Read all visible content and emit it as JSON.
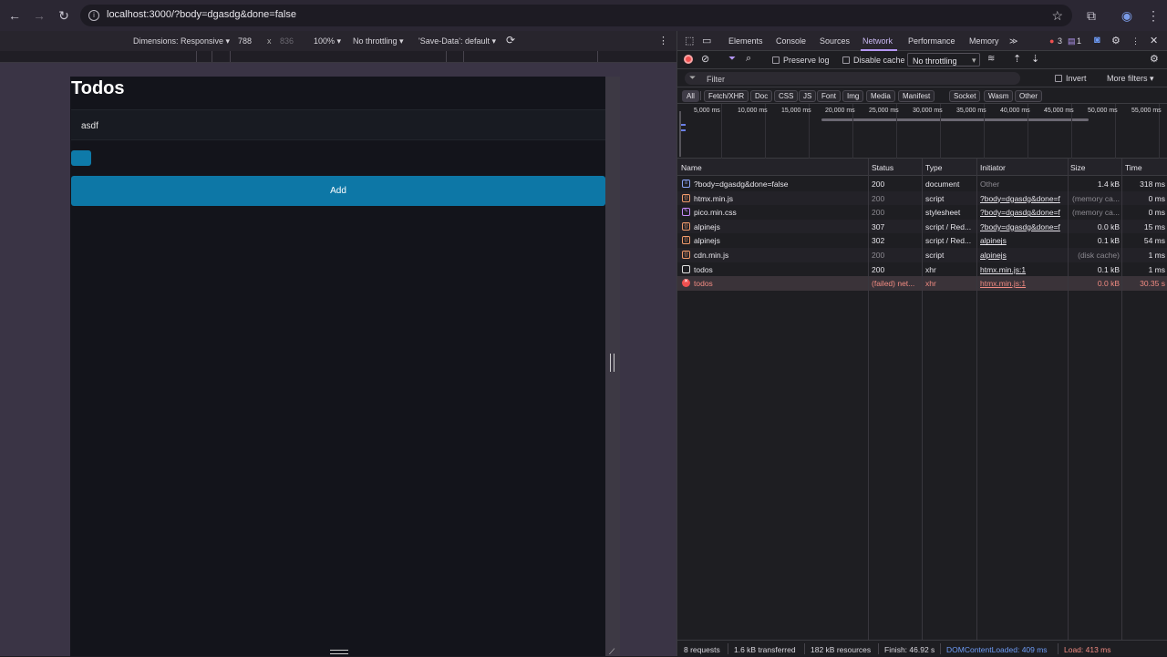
{
  "browser": {
    "url": "localhost:3000/?body=dgasdg&done=false",
    "back_icon": "arrow-left-icon",
    "forward_icon": "arrow-right-icon",
    "reload_icon": "reload-icon"
  },
  "device_toolbar": {
    "dimensions": "Dimensions: Responsive ▾",
    "width": "788",
    "times": "x",
    "height": "836",
    "zoom": "100% ▾",
    "throttling": "No throttling ▾",
    "save_data": "'Save-Data': default ▾"
  },
  "app": {
    "title": "Todos",
    "todo_text": "asdf",
    "add_label": "Add"
  },
  "devtools": {
    "tabs": [
      "Elements",
      "Console",
      "Sources",
      "Network",
      "Performance",
      "Memory"
    ],
    "more_tabs": "≫",
    "error_count": "3",
    "message_count": "1",
    "toolbar": {
      "preserve_log": "Preserve log",
      "disable_cache": "Disable cache",
      "throttling": "No throttling"
    },
    "filter": {
      "placeholder": "Filter",
      "invert": "Invert",
      "more_filters": "More filters ▾"
    },
    "types": [
      "All",
      "Fetch/XHR",
      "Doc",
      "CSS",
      "JS",
      "Font",
      "Img",
      "Media",
      "Manifest",
      "Socket",
      "Wasm",
      "Other"
    ],
    "timeline_labels": [
      "5,000 ms",
      "10,000 ms",
      "15,000 ms",
      "20,000 ms",
      "25,000 ms",
      "30,000 ms",
      "35,000 ms",
      "40,000 ms",
      "45,000 ms",
      "50,000 ms",
      "55,000 ms"
    ],
    "columns": [
      "Name",
      "Status",
      "Type",
      "Initiator",
      "Size",
      "Time"
    ],
    "requests": [
      {
        "name": "?body=dgasdg&done=false",
        "status": "200",
        "type": "document",
        "initiator": "Other",
        "size": "1.4 kB",
        "time": "318 ms"
      },
      {
        "name": "htmx.min.js",
        "status": "200",
        "type": "script",
        "initiator": "?body=dgasdg&done=f",
        "size": "(memory ca...",
        "time": "0 ms"
      },
      {
        "name": "pico.min.css",
        "status": "200",
        "type": "stylesheet",
        "initiator": "?body=dgasdg&done=f",
        "size": "(memory ca...",
        "time": "0 ms"
      },
      {
        "name": "alpinejs",
        "status": "307",
        "type": "script / Red...",
        "initiator": "?body=dgasdg&done=f",
        "size": "0.0 kB",
        "time": "15 ms"
      },
      {
        "name": "alpinejs",
        "status": "302",
        "type": "script / Red...",
        "initiator": "alpinejs",
        "size": "0.1 kB",
        "time": "54 ms"
      },
      {
        "name": "cdn.min.js",
        "status": "200",
        "type": "script",
        "initiator": "alpinejs",
        "size": "(disk cache)",
        "time": "1 ms"
      },
      {
        "name": "todos",
        "status": "200",
        "type": "xhr",
        "initiator": "htmx.min.js:1",
        "size": "0.1 kB",
        "time": "1 ms"
      },
      {
        "name": "todos",
        "status": "(failed) net...",
        "type": "xhr",
        "initiator": "htmx.min.js:1",
        "size": "0.0 kB",
        "time": "30.35 s"
      }
    ],
    "status": {
      "requests": "8 requests",
      "transferred": "1.6 kB transferred",
      "resources": "182 kB resources",
      "finish": "Finish: 46.92 s",
      "dom_loaded": "DOMContentLoaded: 409 ms",
      "load": "Load: 413 ms"
    },
    "colors": {
      "accent": "#b497f3",
      "dom_loaded": "#6e9cf7",
      "load": "#f28b82",
      "button": "#0d77a6"
    }
  }
}
